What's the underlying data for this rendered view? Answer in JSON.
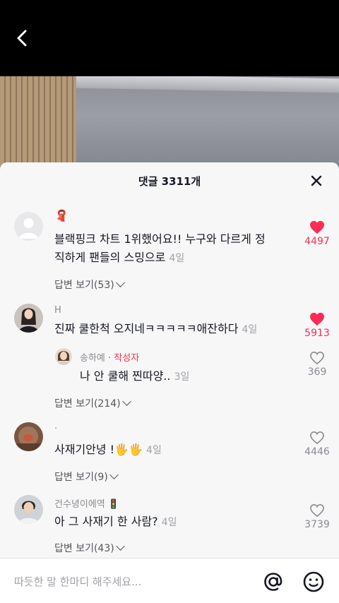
{
  "header": {
    "back_icon": "chevron-left-icon"
  },
  "sheet": {
    "title": "댓글 3311개",
    "close_icon": "close-icon"
  },
  "comments": [
    {
      "username": "🧣",
      "text_line1": "블랙핑크 차트 1위했어요!! 누구와 다르게 정",
      "text_line2": "직하게 팬들의 스밍으로",
      "time": "4일",
      "likes": "4497",
      "liked": true,
      "replies": "답변 보기(53)"
    },
    {
      "username": "H",
      "text": "진짜 쿨한척 오지네ㅋㅋㅋㅋㅋ애잔하다",
      "time": "4일",
      "likes": "5913",
      "liked": true,
      "replies": "답변 보기(214)",
      "reply": {
        "username": "송하예",
        "author_tag": "· 작성자",
        "text": "나 안 쿨해 찐따양..",
        "time": "3일",
        "likes": "369",
        "liked": false
      }
    },
    {
      "username": ".",
      "text": "사재기안녕 !🖐🖐",
      "time": "4일",
      "likes": "4446",
      "liked": false,
      "replies": "답변 보기(9)"
    },
    {
      "username": "건수녕이에역 🚦",
      "text": "아 그 사재기 한 사람?",
      "time": "4일",
      "likes": "3739",
      "liked": false,
      "replies": "답변 보기(43)"
    }
  ],
  "input": {
    "placeholder": "따듯한 말 한마디 해주세요...",
    "at_icon": "at-icon",
    "emoji_icon": "emoji-icon"
  },
  "colors": {
    "accent": "#fe2c55",
    "text": "#161823",
    "muted": "#8a8b91"
  }
}
